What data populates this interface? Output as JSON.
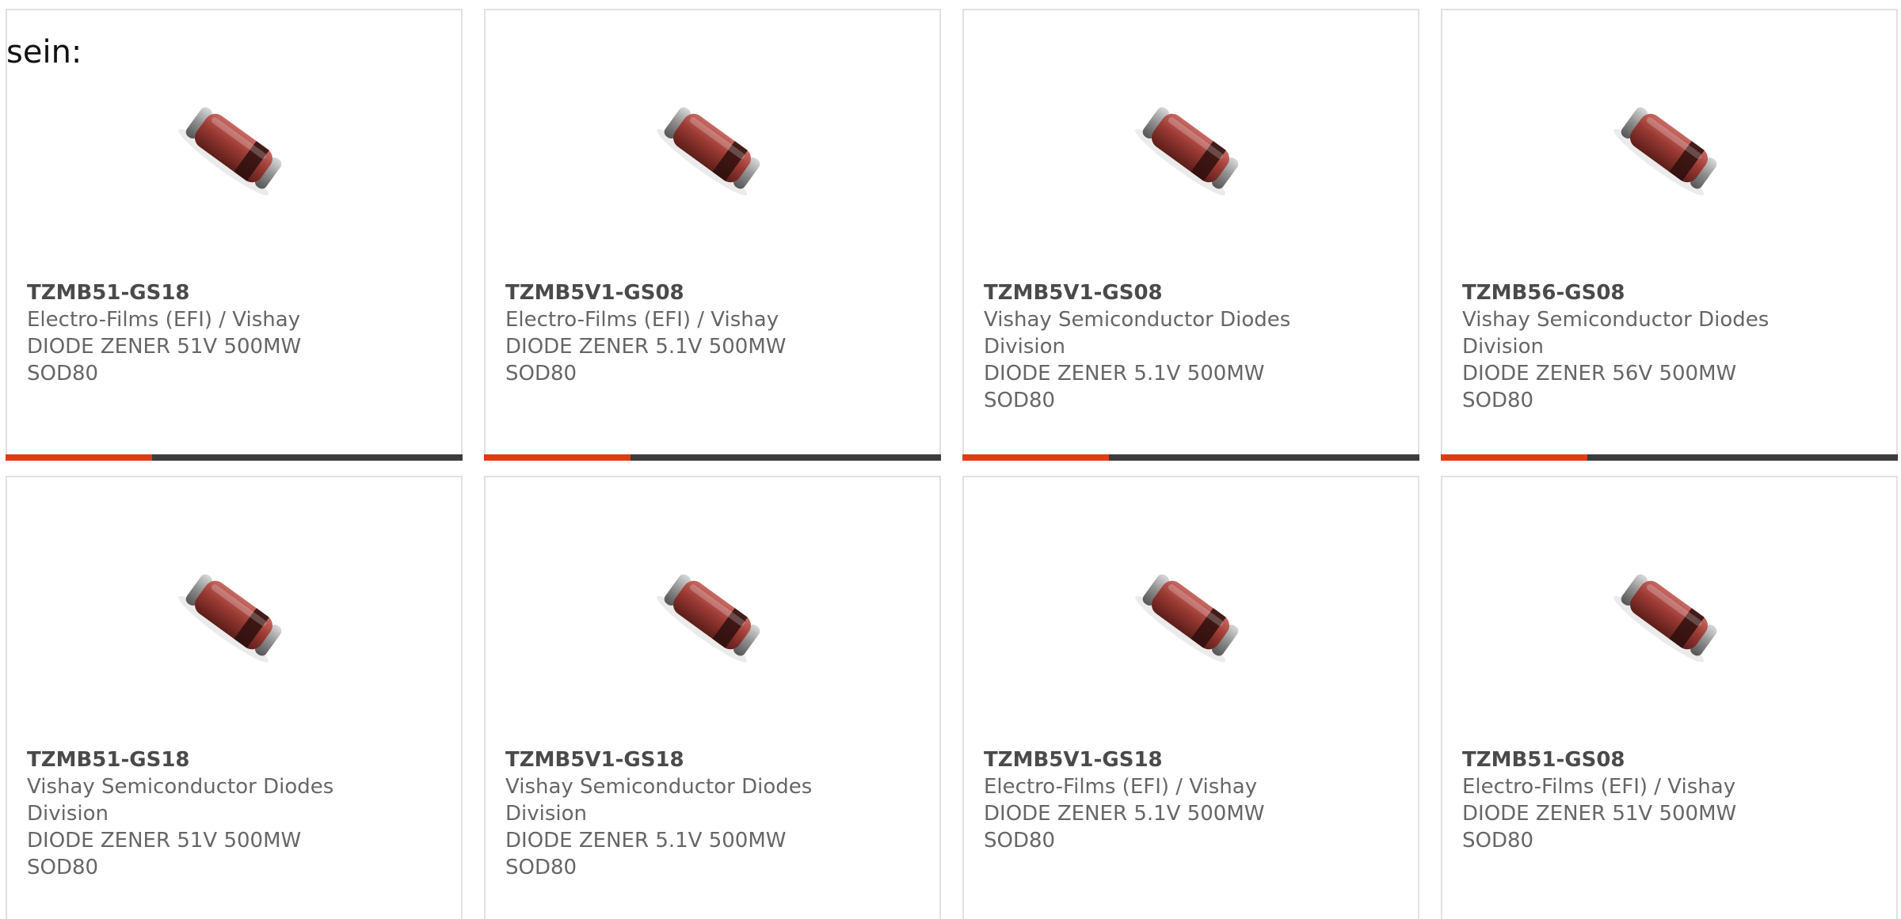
{
  "intro_text": "sein:",
  "colors": {
    "accent": "#e23b12",
    "bar_dark": "#3c3c3c",
    "card_border": "#e1e1e1",
    "text_gray": "#666666"
  },
  "progress_fraction": 0.32,
  "image_alt": "diode-sod80-product-image",
  "products": [
    {
      "part": "TZMB51-GS18",
      "manufacturer": "Electro-Films (EFI) / Vishay",
      "description": "DIODE ZENER 51V 500MW",
      "package": "SOD80"
    },
    {
      "part": "TZMB5V1-GS08",
      "manufacturer": "Electro-Films (EFI) / Vishay",
      "description": "DIODE ZENER 5.1V 500MW",
      "package": "SOD80"
    },
    {
      "part": "TZMB5V1-GS08",
      "manufacturer": "Vishay Semiconductor Diodes Division",
      "description": "DIODE ZENER 5.1V 500MW",
      "package": "SOD80"
    },
    {
      "part": "TZMB56-GS08",
      "manufacturer": "Vishay Semiconductor Diodes Division",
      "description": "DIODE ZENER 56V 500MW",
      "package": "SOD80"
    },
    {
      "part": "TZMB51-GS18",
      "manufacturer": "Vishay Semiconductor Diodes Division",
      "description": "DIODE ZENER 51V 500MW",
      "package": "SOD80"
    },
    {
      "part": "TZMB5V1-GS18",
      "manufacturer": "Vishay Semiconductor Diodes Division",
      "description": "DIODE ZENER 5.1V 500MW",
      "package": "SOD80"
    },
    {
      "part": "TZMB5V1-GS18",
      "manufacturer": "Electro-Films (EFI) / Vishay",
      "description": "DIODE ZENER 5.1V 500MW",
      "package": "SOD80"
    },
    {
      "part": "TZMB51-GS08",
      "manufacturer": "Electro-Films (EFI) / Vishay",
      "description": "DIODE ZENER 51V 500MW",
      "package": "SOD80"
    }
  ]
}
